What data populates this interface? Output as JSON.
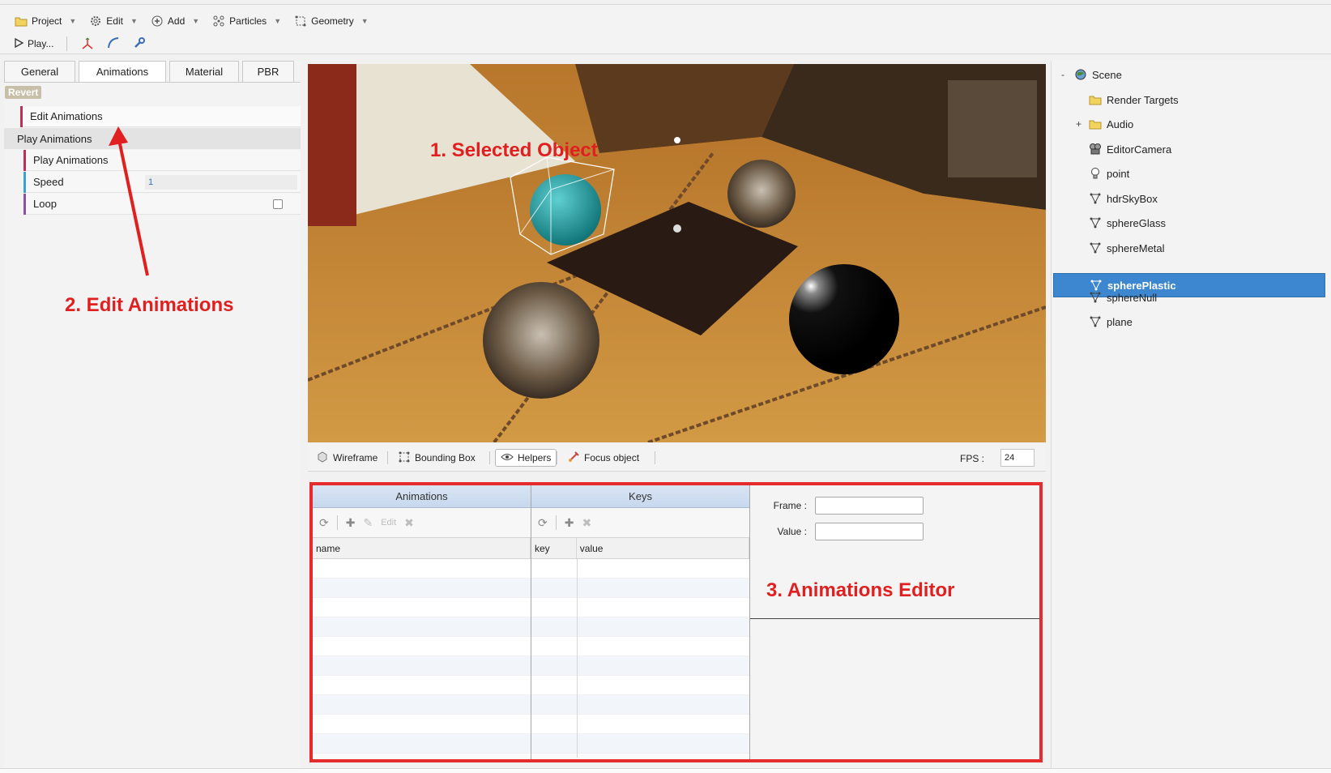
{
  "menu": {
    "project": "Project",
    "edit": "Edit",
    "add": "Add",
    "particles": "Particles",
    "geometry": "Geometry"
  },
  "toolbar": {
    "play": "Play..."
  },
  "left_panel": {
    "tabs": [
      "General",
      "Animations",
      "Material",
      "PBR"
    ],
    "revert": "Revert",
    "edit_animations": "Edit Animations",
    "play_animations_group": "Play Animations",
    "play_animations": "Play Animations",
    "speed_label": "Speed",
    "speed_value": "1",
    "loop_label": "Loop"
  },
  "viewport_bar": {
    "wireframe": "Wireframe",
    "bounding_box": "Bounding Box",
    "helpers": "Helpers",
    "focus_object": "Focus object",
    "fps_label": "FPS :",
    "fps_value": "24"
  },
  "editor": {
    "animations_title": "Animations",
    "keys_title": "Keys",
    "edit_label": "Edit",
    "name_col": "name",
    "key_col": "key",
    "value_col": "value",
    "frame_label": "Frame :",
    "value_label": "Value :"
  },
  "scene_tree": {
    "items": [
      {
        "label": "Scene",
        "icon": "scene-icon",
        "toggle": "-"
      },
      {
        "label": "Render Targets",
        "icon": "folder-icon",
        "toggle": ""
      },
      {
        "label": "Audio",
        "icon": "folder-icon",
        "toggle": "+"
      },
      {
        "label": "EditorCamera",
        "icon": "camera-icon",
        "toggle": ""
      },
      {
        "label": "point",
        "icon": "light-bulb-icon",
        "toggle": ""
      },
      {
        "label": "hdrSkyBox",
        "icon": "mesh-icon",
        "toggle": ""
      },
      {
        "label": "sphereGlass",
        "icon": "mesh-icon",
        "toggle": ""
      },
      {
        "label": "sphereMetal",
        "icon": "mesh-icon",
        "toggle": ""
      },
      {
        "label": "spherePlastic",
        "icon": "mesh-icon",
        "toggle": "",
        "selected": true
      },
      {
        "label": "sphereNull",
        "icon": "mesh-icon",
        "toggle": ""
      },
      {
        "label": "plane",
        "icon": "mesh-icon",
        "toggle": ""
      }
    ]
  },
  "annotations": {
    "selected_object": "1. Selected Object",
    "edit_animations": "2. Edit Animations",
    "animations_editor": "3. Animations Editor"
  },
  "colors": {
    "annotation": "#e02020",
    "selection": "#3c87cf"
  }
}
